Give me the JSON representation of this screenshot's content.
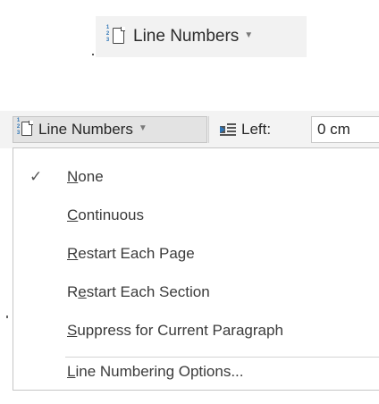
{
  "top_button": {
    "label": "Line Numbers",
    "icon": "line-numbers-icon"
  },
  "ribbon": {
    "line_numbers_label": "Line Numbers",
    "left_label": "Left:",
    "left_value": "0 cm"
  },
  "menu": {
    "items": [
      {
        "pre": "",
        "key": "N",
        "post": "one",
        "checked": true
      },
      {
        "pre": "",
        "key": "C",
        "post": "ontinuous",
        "checked": false
      },
      {
        "pre": "",
        "key": "R",
        "post": "estart Each Page",
        "checked": false
      },
      {
        "pre": "R",
        "key": "e",
        "post": "start Each Section",
        "checked": false
      },
      {
        "pre": "",
        "key": "S",
        "post": "uppress for Current Paragraph",
        "checked": false
      },
      {
        "pre": "",
        "key": "L",
        "post": "ine Numbering Options...",
        "checked": false
      }
    ],
    "check_glyph": "✓"
  },
  "colors": {
    "accent": "#2e75b6",
    "ribbon_bg": "#f3f3f3",
    "button_bg": "#f2f2f2"
  }
}
